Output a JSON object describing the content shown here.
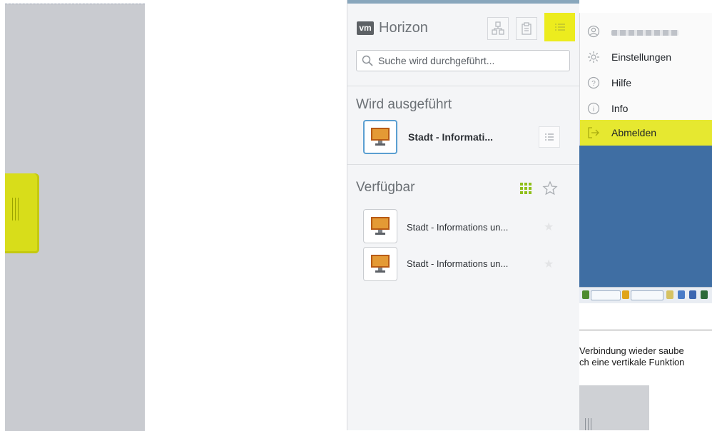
{
  "horizon": {
    "brand": "Horizon",
    "logo_text": "vm",
    "search_placeholder": "Suche wird durchgeführt...",
    "running_section_title": "Wird ausgeführt",
    "running_items": [
      {
        "label": "Stadt - Informati..."
      }
    ],
    "available_section_title": "Verfügbar",
    "available_items": [
      {
        "label": "Stadt - Informations un..."
      },
      {
        "label": "Stadt - Informations un..."
      }
    ]
  },
  "menu": {
    "items": [
      {
        "label": "Einstellungen",
        "icon": "gear-icon"
      },
      {
        "label": "Hilfe",
        "icon": "help-icon"
      },
      {
        "label": "Info",
        "icon": "info-icon"
      },
      {
        "label": "Abmelden",
        "icon": "logout-icon"
      }
    ],
    "user_icon": "user-icon"
  },
  "background_doc": {
    "line1": "Verbindung wieder saube",
    "line2": "ch eine vertikale Funktion"
  },
  "colors": {
    "highlight": "#e6e830",
    "panel": "#f4f5f7",
    "desktop_blue": "#3f6ea3"
  }
}
